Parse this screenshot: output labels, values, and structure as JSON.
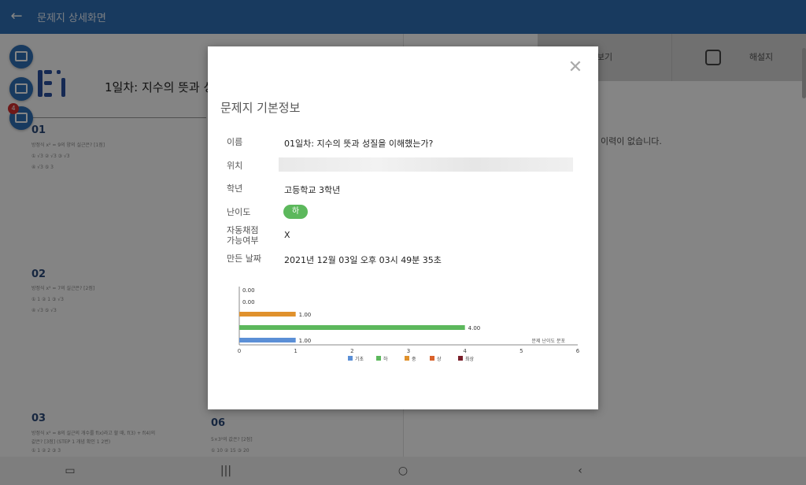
{
  "app": {
    "title": "문제지 상세화면"
  },
  "tabs": {
    "view": "보기",
    "solution": "해설지"
  },
  "history_text": "이력이 없습니다.",
  "sheet": {
    "title": "1일차: 지수의 뜻과 성",
    "questions": [
      {
        "num": "01",
        "line1": "방정식 x² = 9의 양의 실근은? [1점]",
        "opt1": "① √3   ② √3   ③ √3",
        "opt2": "④ √3   ⑤ 3"
      },
      {
        "num": "02",
        "line1": "방정식 x³ = 7의 실근은? [2점]",
        "opt1": "① 1   ② 1   ③ √3",
        "opt2": "④ √3   ⑤ √3"
      },
      {
        "num": "03",
        "line1": "방정식 x³ = 8의 실근의 개수를 f(x)라고 할 때, f(3) + f(4)의",
        "opt1": "값은? [3점] (STEP 1 개념 확인 1 2번)",
        "opt2": "① 1   ② 2   ③ 3"
      },
      {
        "num": "06",
        "line1": "5×3²의 값은? [2점]",
        "opt1": "① 10   ② 15   ③ 20",
        "opt2": ""
      }
    ]
  },
  "side_badge": "4",
  "modal": {
    "title": "문제지 기본정보",
    "rows": {
      "name_label": "이름",
      "name_value": "01일차: 지수의 뜻과 성질을 이해했는가?",
      "location_label": "위치",
      "grade_label": "학년",
      "grade_value": "고등학교 3학년",
      "difficulty_label": "난이도",
      "difficulty_value": "하",
      "auto_label_1": "자동채점",
      "auto_label_2": "가능여부",
      "auto_value": "X",
      "date_label": "만든 날짜",
      "date_value": "2021년 12월 03일 오후 03시 49분 35초"
    }
  },
  "chart_data": {
    "type": "bar",
    "orientation": "horizontal",
    "xlim": [
      0,
      6
    ],
    "ticks": [
      "0",
      "1",
      "2",
      "3",
      "4",
      "5",
      "6"
    ],
    "bars": [
      {
        "category": "최상",
        "value": 0.0,
        "label": "0.00",
        "color": "#7a1f2b"
      },
      {
        "category": "상",
        "value": 0.0,
        "label": "0.00",
        "color": "#d9622b"
      },
      {
        "category": "중",
        "value": 1.0,
        "label": "1.00",
        "color": "#e0912c"
      },
      {
        "category": "하",
        "value": 4.0,
        "label": "4.00",
        "color": "#5cb85c"
      },
      {
        "category": "기초",
        "value": 1.0,
        "label": "1.00",
        "color": "#5b8fd6"
      }
    ],
    "legend": [
      {
        "name": "기초",
        "color": "#5b8fd6"
      },
      {
        "name": "하",
        "color": "#5cb85c"
      },
      {
        "name": "중",
        "color": "#e0912c"
      },
      {
        "name": "상",
        "color": "#d9622b"
      },
      {
        "name": "최상",
        "color": "#7a1f2b"
      }
    ],
    "annotation": "문제 난이도 분포",
    "legend_position": "bottom"
  }
}
